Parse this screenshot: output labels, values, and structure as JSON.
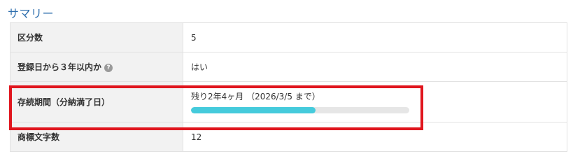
{
  "summary": {
    "title": "サマリー",
    "rows": [
      {
        "label": "区分数",
        "value": "5"
      },
      {
        "label": "登録日から３年以内か",
        "help": "?",
        "value": "はい"
      },
      {
        "label": "存続期間（分納満了日）",
        "value": "残り2年4ヶ月 （2026/3/5 まで）",
        "progress": 0.57
      },
      {
        "label": "商標文字数",
        "value": "12"
      }
    ]
  },
  "colors": {
    "title": "#2f6fae",
    "progress_fill": "#45cbdc",
    "progress_track": "#e6e6e6",
    "highlight": "#e0161e"
  },
  "icons": {
    "help": "question-circle-icon"
  }
}
